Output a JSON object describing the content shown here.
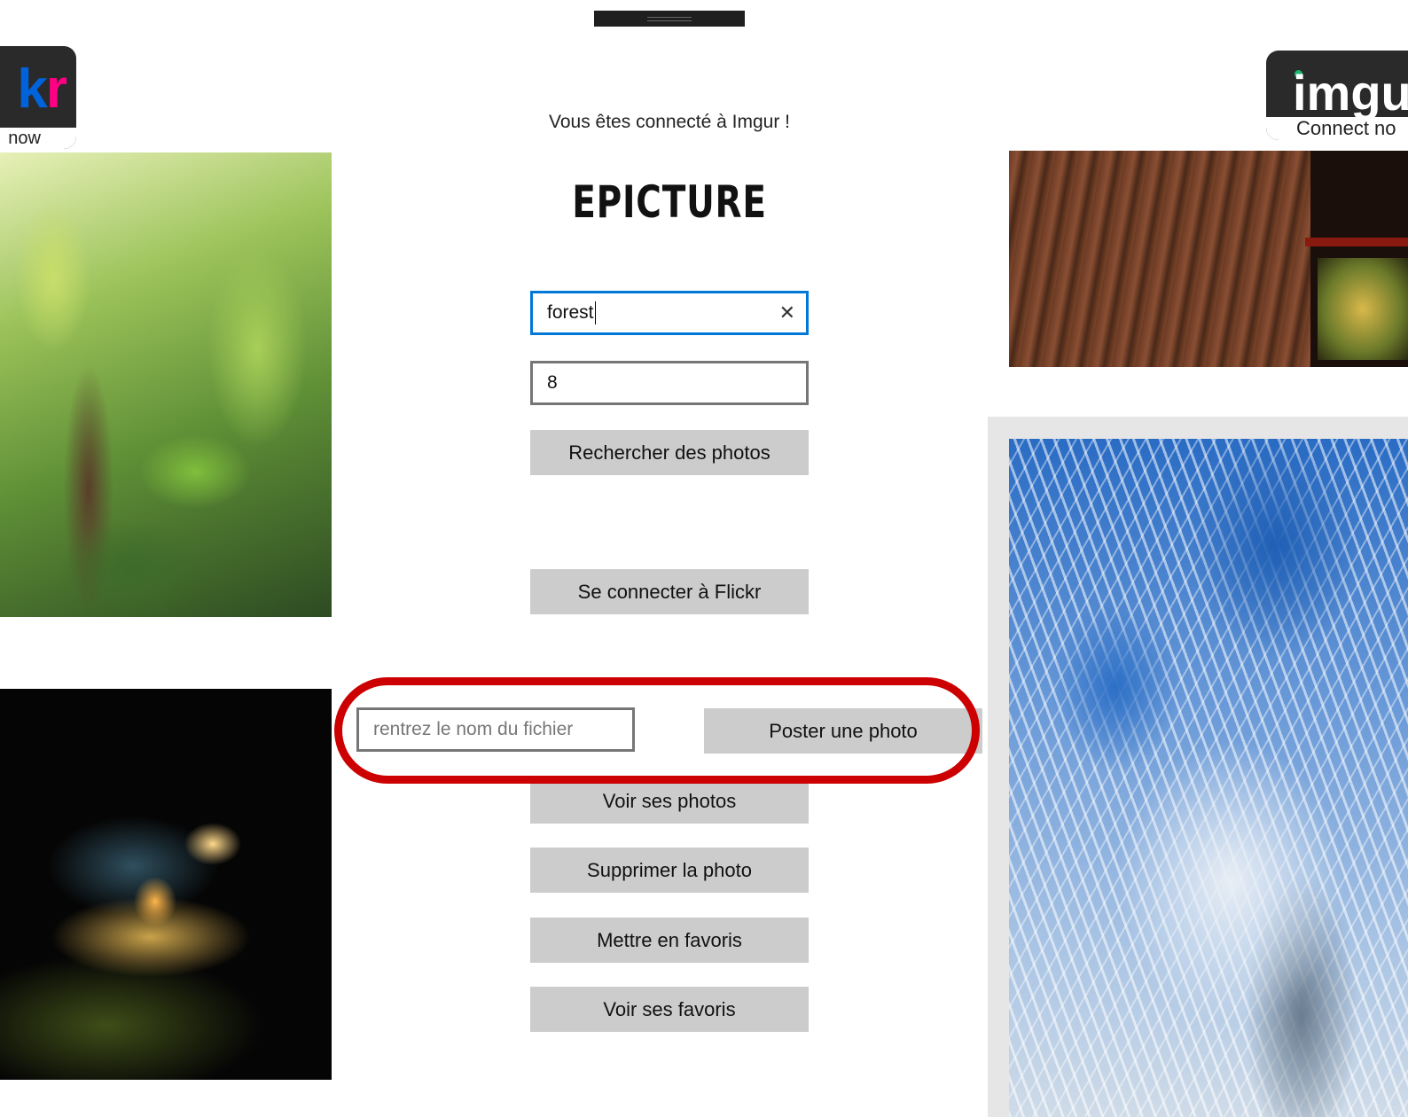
{
  "logos": {
    "flickr": {
      "word_start": "k",
      "word_end": "r",
      "tagline": "now"
    },
    "imgur": {
      "word": "imgu",
      "tagline": "Connect no"
    }
  },
  "status": {
    "message": "Vous êtes connecté à Imgur !"
  },
  "app": {
    "title": "EPICTURE"
  },
  "search": {
    "query": "forest",
    "count": "8",
    "button_label": "Rechercher des photos"
  },
  "flickr": {
    "connect_label": "Se connecter à Flickr"
  },
  "upload": {
    "filename_placeholder": "rentrez le nom du fichier",
    "post_label": "Poster une photo"
  },
  "actions": {
    "view_photos": "Voir ses photos",
    "delete_photo": "Supprimer la photo",
    "add_favorite": "Mettre en favoris",
    "view_favorites": "Voir ses favoris"
  },
  "icons": {
    "clear": "close-icon"
  },
  "colors": {
    "focus_border": "#0078d7",
    "highlight": "#cc0000",
    "button_bg": "#cccccc",
    "flickr_blue": "#0063dc",
    "flickr_pink": "#ff0084",
    "imgur_green": "#1bb76e"
  }
}
